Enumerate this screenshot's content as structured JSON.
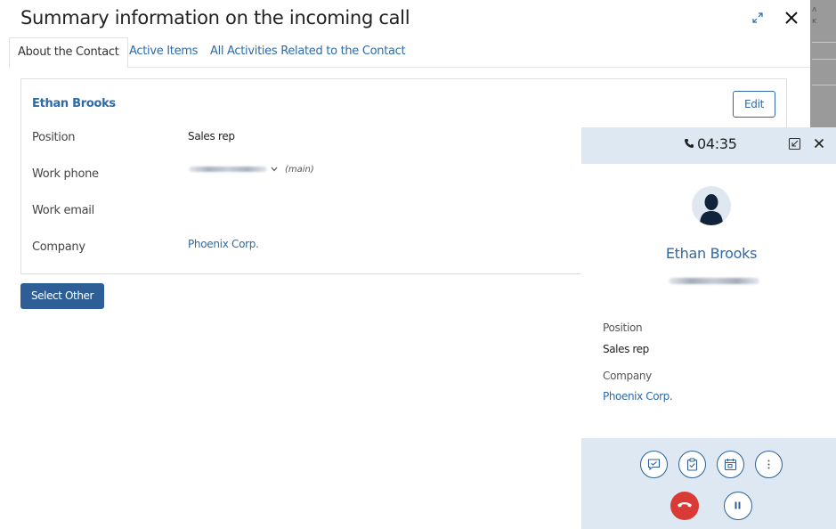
{
  "dialog": {
    "title": "Summary information on the incoming call",
    "tabs": [
      {
        "label": "About the Contact",
        "active": true
      },
      {
        "label": "Active Items",
        "active": false
      },
      {
        "label": "All Activities Related to the Contact",
        "active": false
      }
    ]
  },
  "contact": {
    "name": "Ethan Brooks",
    "edit_label": "Edit",
    "fields": [
      {
        "label": "Position",
        "value": "Sales rep"
      },
      {
        "label": "Work phone",
        "value": "",
        "type": "(main)"
      },
      {
        "label": "Work email",
        "value": ""
      },
      {
        "label": "Company",
        "value": "Phoenix Corp."
      }
    ]
  },
  "select_other_label": "Select Other",
  "call_panel": {
    "timer": "04:35",
    "caller_name": "Ethan Brooks",
    "position_label": "Position",
    "position_value": "Sales rep",
    "company_label": "Company",
    "company_value": "Phoenix Corp."
  },
  "colors": {
    "accent": "#2d6aa8",
    "button": "#2d5f96",
    "panel_bg": "#dde8f2",
    "hangup": "#d93a35"
  }
}
